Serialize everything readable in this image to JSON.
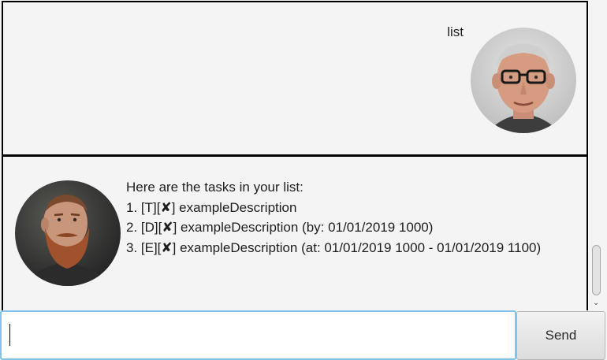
{
  "dialog": {
    "user": {
      "text": "list",
      "avatar_icon": "user-portrait-older-man-glasses"
    },
    "bot": {
      "lines": [
        "Here are the tasks in your list:",
        "1. [T][✘] exampleDescription",
        "2. [D][✘] exampleDescription (by: 01/01/2019 1000)",
        "3. [E][✘] exampleDescription (at: 01/01/2019 1000 - 01/01/2019 1100)"
      ],
      "avatar_icon": "bot-portrait-bearded-man"
    }
  },
  "input": {
    "value": "",
    "placeholder": ""
  },
  "send_button": {
    "label": "Send"
  },
  "scrollbar": {
    "down_arrow": "⌄",
    "position": 1.0
  },
  "colors": {
    "background": "#f4f4f4",
    "input_focus_border": "#7fc3e8",
    "dialog_border": "#000000"
  }
}
